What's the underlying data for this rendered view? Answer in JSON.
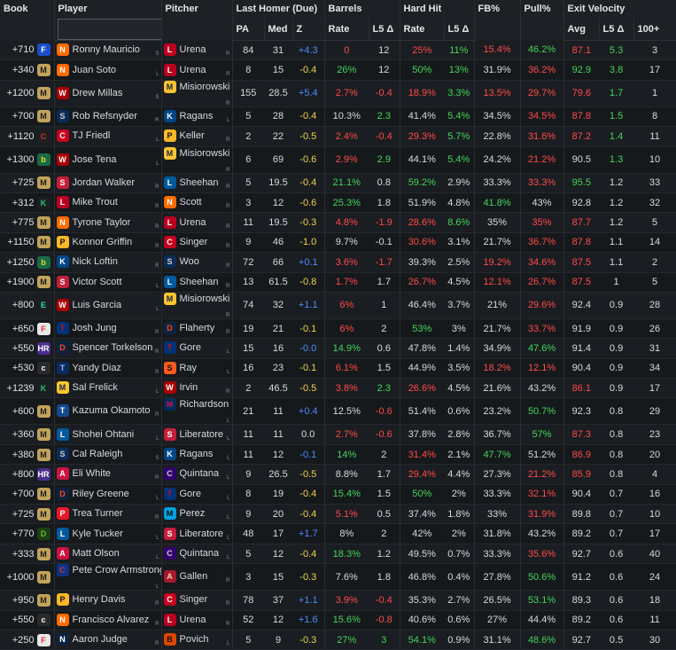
{
  "headers": {
    "book": "Book",
    "player": "Player",
    "pitcher": "Pitcher",
    "last_homer": "Last Homer (Due)",
    "barrels": "Barrels",
    "hard_hit": "Hard Hit",
    "fb": "FB%",
    "pull": "Pull%",
    "exit_velocity": "Exit Velocity",
    "pa": "PA",
    "med": "Med",
    "z": "Z",
    "rate1": "Rate",
    "l5a": "L5 Δ",
    "rate2": "Rate",
    "l5b": "L5 Δ",
    "avg": "Avg",
    "l5c": "L5 Δ",
    "hundred": "100+"
  },
  "search": {
    "placeholder": ""
  },
  "colors": {
    "negative": "#ff4a4a",
    "positive": "#43d55a",
    "z_positive": "#4d8cff",
    "bold_green": "#2ee14a"
  },
  "rows": [
    {
      "odds": "+710",
      "book": "fanduel",
      "player": "Ronny Mauricio",
      "ph": "S",
      "team": "NYM",
      "pitcher": "Urena",
      "th": "R",
      "pt": "LAA",
      "pa": "84",
      "med": "31",
      "z": "+4.3",
      "zc": "blue",
      "brate": "0",
      "brc": "neg",
      "bl5": "12",
      "bl5c": "",
      "hrate": "25%",
      "hrc": "neg",
      "hl5": "11%",
      "hl5c": "pos",
      "fb": "15.4%",
      "fbc": "neg",
      "pull": "46.2%",
      "pc": "pos",
      "avg": "87.1",
      "ac": "neg",
      "el5": "5.3",
      "ec": "pos",
      "hund": "3"
    },
    {
      "odds": "+340",
      "book": "mgm",
      "player": "Juan Soto",
      "ph": "L",
      "team": "NYM",
      "pitcher": "Urena",
      "th": "R",
      "pt": "LAA",
      "pa": "8",
      "med": "15",
      "z": "-0.4",
      "zc": "yel",
      "brate": "26%",
      "brc": "pos",
      "bl5": "12",
      "bl5c": "",
      "hrate": "50%",
      "hrc": "pos",
      "hl5": "13%",
      "hl5c": "pos",
      "fb": "31.9%",
      "fbc": "",
      "pull": "36.2%",
      "pc": "neg",
      "avg": "92.9",
      "ac": "pos",
      "el5": "3.8",
      "ec": "pos",
      "hund": "17"
    },
    {
      "odds": "+1200",
      "book": "mgm",
      "player": "Drew Millas",
      "ph": "S",
      "team": "WSH",
      "pitcher": "Misiorowski",
      "th": "R",
      "pt": "MIL",
      "pa": "155",
      "med": "28.5",
      "z": "+5.4",
      "zc": "blue",
      "brate": "2.7%",
      "brc": "neg",
      "bl5": "-0.4",
      "bl5c": "neg",
      "hrate": "18.9%",
      "hrc": "neg",
      "hl5": "3.3%",
      "hl5c": "pos",
      "fb": "13.5%",
      "fbc": "neg",
      "pull": "29.7%",
      "pc": "neg",
      "avg": "79.6",
      "ac": "neg",
      "el5": "1.7",
      "ec": "pos",
      "hund": "1"
    },
    {
      "odds": "+700",
      "book": "mgm",
      "player": "Rob Refsnyder",
      "ph": "R",
      "team": "SEA",
      "pitcher": "Ragans",
      "th": "L",
      "pt": "KC",
      "pa": "5",
      "med": "28",
      "z": "-0.4",
      "zc": "yel",
      "brate": "10.3%",
      "brc": "",
      "bl5": "2.3",
      "bl5c": "pos",
      "hrate": "41.4%",
      "hrc": "",
      "hl5": "5.4%",
      "hl5c": "pos",
      "fb": "34.5%",
      "fbc": "",
      "pull": "34.5%",
      "pc": "neg",
      "avg": "87.8",
      "ac": "neg",
      "el5": "1.5",
      "ec": "pos",
      "hund": "8"
    },
    {
      "odds": "+1120",
      "book": "caesars",
      "player": "TJ Friedl",
      "ph": "L",
      "team": "CIN",
      "pitcher": "Keller",
      "th": "R",
      "pt": "PIT",
      "pa": "2",
      "med": "22",
      "z": "-0.5",
      "zc": "yel",
      "brate": "2.4%",
      "brc": "neg",
      "bl5": "-0.4",
      "bl5c": "neg",
      "hrate": "29.3%",
      "hrc": "neg",
      "hl5": "5.7%",
      "hl5c": "pos",
      "fb": "22.8%",
      "fbc": "",
      "pull": "31.6%",
      "pc": "neg",
      "avg": "87.2",
      "ac": "neg",
      "el5": "1.4",
      "ec": "pos",
      "hund": "11"
    },
    {
      "odds": "+1300",
      "book": "bet365",
      "player": "Jose Tena",
      "ph": "L",
      "team": "WSH",
      "pitcher": "Misiorowski",
      "th": "R",
      "pt": "MIL",
      "pa": "6",
      "med": "69",
      "z": "-0.6",
      "zc": "yel",
      "brate": "2.9%",
      "brc": "neg",
      "bl5": "2.9",
      "bl5c": "pos",
      "hrate": "44.1%",
      "hrc": "",
      "hl5": "5.4%",
      "hl5c": "pos",
      "fb": "24.2%",
      "fbc": "",
      "pull": "21.2%",
      "pc": "neg",
      "avg": "90.5",
      "ac": "",
      "el5": "1.3",
      "ec": "pos",
      "hund": "10"
    },
    {
      "odds": "+725",
      "book": "mgm",
      "player": "Jordan Walker",
      "ph": "R",
      "team": "STL",
      "pitcher": "Sheehan",
      "th": "R",
      "pt": "LAD",
      "pa": "5",
      "med": "19.5",
      "z": "-0.4",
      "zc": "yel",
      "brate": "21.1%",
      "brc": "pos",
      "bl5": "0.8",
      "bl5c": "",
      "hrate": "59.2%",
      "hrc": "pos",
      "hl5": "2.9%",
      "hl5c": "",
      "fb": "33.3%",
      "fbc": "",
      "pull": "33.3%",
      "pc": "neg",
      "avg": "95.5",
      "ac": "pos",
      "el5": "1.2",
      "ec": "",
      "hund": "33"
    },
    {
      "odds": "+312",
      "book": "kalshi",
      "player": "Mike Trout",
      "ph": "R",
      "team": "LAA",
      "pitcher": "Scott",
      "th": "R",
      "pt": "NYM",
      "pa": "3",
      "med": "12",
      "z": "-0.6",
      "zc": "yel",
      "brate": "25.3%",
      "brc": "pos",
      "bl5": "1.8",
      "bl5c": "",
      "hrate": "51.9%",
      "hrc": "",
      "hl5": "4.8%",
      "hl5c": "",
      "fb": "41.8%",
      "fbc": "pos",
      "pull": "43%",
      "pc": "",
      "avg": "92.8",
      "ac": "",
      "el5": "1.2",
      "ec": "",
      "hund": "32"
    },
    {
      "odds": "+775",
      "book": "mgm",
      "player": "Tyrone Taylor",
      "ph": "R",
      "team": "NYM",
      "pitcher": "Urena",
      "th": "R",
      "pt": "LAA",
      "pa": "11",
      "med": "19.5",
      "z": "-0.3",
      "zc": "yel",
      "brate": "4.8%",
      "brc": "neg",
      "bl5": "-1.9",
      "bl5c": "neg",
      "hrate": "28.6%",
      "hrc": "neg",
      "hl5": "8.6%",
      "hl5c": "pos",
      "fb": "35%",
      "fbc": "",
      "pull": "35%",
      "pc": "neg",
      "avg": "87.7",
      "ac": "neg",
      "el5": "1.2",
      "ec": "",
      "hund": "5"
    },
    {
      "odds": "+1150",
      "book": "mgm",
      "player": "Konnor Griffin",
      "ph": "R",
      "team": "PIT",
      "pitcher": "Singer",
      "th": "R",
      "pt": "CIN",
      "pa": "9",
      "med": "46",
      "z": "-1.0",
      "zc": "yel",
      "brate": "9.7%",
      "brc": "",
      "bl5": "-0.1",
      "bl5c": "",
      "hrate": "30.6%",
      "hrc": "neg",
      "hl5": "3.1%",
      "hl5c": "",
      "fb": "21.7%",
      "fbc": "",
      "pull": "36.7%",
      "pc": "neg",
      "avg": "87.8",
      "ac": "neg",
      "el5": "1.1",
      "ec": "",
      "hund": "14"
    },
    {
      "odds": "+1250",
      "book": "bet365",
      "player": "Nick Loftin",
      "ph": "R",
      "team": "KC",
      "pitcher": "Woo",
      "th": "R",
      "pt": "SEA",
      "pa": "72",
      "med": "66",
      "z": "+0.1",
      "zc": "blue",
      "brate": "3.6%",
      "brc": "neg",
      "bl5": "-1.7",
      "bl5c": "neg",
      "hrate": "39.3%",
      "hrc": "",
      "hl5": "2.5%",
      "hl5c": "",
      "fb": "19.2%",
      "fbc": "neg",
      "pull": "34.6%",
      "pc": "neg",
      "avg": "87.5",
      "ac": "neg",
      "el5": "1.1",
      "ec": "",
      "hund": "2"
    },
    {
      "odds": "+1900",
      "book": "mgm",
      "player": "Victor Scott",
      "ph": "L",
      "team": "STL",
      "pitcher": "Sheehan",
      "th": "R",
      "pt": "LAD",
      "pa": "13",
      "med": "61.5",
      "z": "-0.8",
      "zc": "yel",
      "brate": "1.7%",
      "brc": "neg",
      "bl5": "1.7",
      "bl5c": "",
      "hrate": "26.7%",
      "hrc": "neg",
      "hl5": "4.5%",
      "hl5c": "",
      "fb": "12.1%",
      "fbc": "neg",
      "pull": "26.7%",
      "pc": "neg",
      "avg": "87.5",
      "ac": "neg",
      "el5": "1",
      "ec": "",
      "hund": "5"
    },
    {
      "odds": "+800",
      "book": "espn",
      "player": "Luis Garcia",
      "ph": "L",
      "team": "WSH",
      "pitcher": "Misiorowski",
      "th": "R",
      "pt": "MIL",
      "pa": "74",
      "med": "32",
      "z": "+1.1",
      "zc": "blue",
      "brate": "6%",
      "brc": "neg",
      "bl5": "1",
      "bl5c": "",
      "hrate": "46.4%",
      "hrc": "",
      "hl5": "3.7%",
      "hl5c": "",
      "fb": "21%",
      "fbc": "",
      "pull": "29.6%",
      "pc": "neg",
      "avg": "92.4",
      "ac": "",
      "el5": "0.9",
      "ec": "",
      "hund": "28"
    },
    {
      "odds": "+650",
      "book": "fanatics",
      "player": "Josh Jung",
      "ph": "R",
      "team": "TEX",
      "pitcher": "Flaherty",
      "th": "R",
      "pt": "DET",
      "pa": "19",
      "med": "21",
      "z": "-0.1",
      "zc": "yel",
      "brate": "6%",
      "brc": "neg",
      "bl5": "2",
      "bl5c": "",
      "hrate": "53%",
      "hrc": "pos",
      "hl5": "3%",
      "hl5c": "",
      "fb": "21.7%",
      "fbc": "",
      "pull": "33.7%",
      "pc": "neg",
      "avg": "91.9",
      "ac": "",
      "el5": "0.9",
      "ec": "",
      "hund": "26"
    },
    {
      "odds": "+550",
      "book": "hardrock",
      "player": "Spencer Torkelson",
      "ph": "R",
      "team": "DET",
      "pitcher": "Gore",
      "th": "L",
      "pt": "TEX",
      "pa": "15",
      "med": "16",
      "z": "-0.0",
      "zc": "blue",
      "brate": "14.9%",
      "brc": "pos",
      "bl5": "0.6",
      "bl5c": "",
      "hrate": "47.8%",
      "hrc": "",
      "hl5": "1.4%",
      "hl5c": "",
      "fb": "34.9%",
      "fbc": "",
      "pull": "47.6%",
      "pc": "pos",
      "avg": "91.4",
      "ac": "",
      "el5": "0.9",
      "ec": "",
      "hund": "31"
    },
    {
      "odds": "+530",
      "book": "circa",
      "player": "Yandy Diaz",
      "ph": "R",
      "team": "TB",
      "pitcher": "Ray",
      "th": "L",
      "pt": "SF",
      "pa": "16",
      "med": "23",
      "z": "-0.1",
      "zc": "yel",
      "brate": "6.1%",
      "brc": "neg",
      "bl5": "1.5",
      "bl5c": "",
      "hrate": "44.9%",
      "hrc": "",
      "hl5": "3.5%",
      "hl5c": "",
      "fb": "18.2%",
      "fbc": "neg",
      "pull": "12.1%",
      "pc": "neg",
      "avg": "90.4",
      "ac": "",
      "el5": "0.9",
      "ec": "",
      "hund": "34"
    },
    {
      "odds": "+1239",
      "book": "kalshi",
      "player": "Sal Frelick",
      "ph": "L",
      "team": "MIL",
      "pitcher": "Irvin",
      "th": "R",
      "pt": "WSH",
      "pa": "2",
      "med": "46.5",
      "z": "-0.5",
      "zc": "yel",
      "brate": "3.8%",
      "brc": "neg",
      "bl5": "2.3",
      "bl5c": "pos",
      "hrate": "26.6%",
      "hrc": "neg",
      "hl5": "4.5%",
      "hl5c": "",
      "fb": "21.6%",
      "fbc": "",
      "pull": "43.2%",
      "pc": "",
      "avg": "86.1",
      "ac": "neg",
      "el5": "0.9",
      "ec": "",
      "hund": "17"
    },
    {
      "odds": "+600",
      "book": "mgm",
      "player": "Kazuma Okamoto",
      "ph": "R",
      "team": "TOR",
      "pitcher": "Richardson",
      "th": "L",
      "pt": "MIN",
      "pa": "21",
      "med": "11",
      "z": "+0.4",
      "zc": "blue",
      "brate": "12.5%",
      "brc": "",
      "bl5": "-0.6",
      "bl5c": "neg",
      "hrate": "51.4%",
      "hrc": "",
      "hl5": "0.6%",
      "hl5c": "",
      "fb": "23.2%",
      "fbc": "",
      "pull": "50.7%",
      "pc": "pos",
      "avg": "92.3",
      "ac": "",
      "el5": "0.8",
      "ec": "",
      "hund": "29"
    },
    {
      "odds": "+360",
      "book": "mgm",
      "player": "Shohei Ohtani",
      "ph": "L",
      "team": "LAD",
      "pitcher": "Liberatore",
      "th": "L",
      "pt": "STL",
      "pa": "11",
      "med": "11",
      "z": "0.0",
      "zc": "",
      "brate": "2.7%",
      "brc": "neg",
      "bl5": "-0.6",
      "bl5c": "neg",
      "hrate": "37.8%",
      "hrc": "",
      "hl5": "2.8%",
      "hl5c": "",
      "fb": "36.7%",
      "fbc": "",
      "pull": "57%",
      "pc": "pos",
      "avg": "87.3",
      "ac": "neg",
      "el5": "0.8",
      "ec": "",
      "hund": "23"
    },
    {
      "odds": "+380",
      "book": "mgm",
      "player": "Cal Raleigh",
      "ph": "S",
      "team": "SEA",
      "pitcher": "Ragans",
      "th": "L",
      "pt": "KC",
      "pa": "11",
      "med": "12",
      "z": "-0.1",
      "zc": "blue",
      "brate": "14%",
      "brc": "pos",
      "bl5": "2",
      "bl5c": "",
      "hrate": "31.4%",
      "hrc": "neg",
      "hl5": "2.1%",
      "hl5c": "",
      "fb": "47.7%",
      "fbc": "pos",
      "pull": "51.2%",
      "pc": "",
      "avg": "86.9",
      "ac": "neg",
      "el5": "0.8",
      "ec": "",
      "hund": "20"
    },
    {
      "odds": "+800",
      "book": "hardrock",
      "player": "Eli White",
      "ph": "R",
      "team": "ATL",
      "pitcher": "Quintana",
      "th": "L",
      "pt": "COL",
      "pa": "9",
      "med": "26.5",
      "z": "-0.5",
      "zc": "yel",
      "brate": "8.8%",
      "brc": "",
      "bl5": "1.7",
      "bl5c": "",
      "hrate": "29.4%",
      "hrc": "neg",
      "hl5": "4.4%",
      "hl5c": "",
      "fb": "27.3%",
      "fbc": "",
      "pull": "21.2%",
      "pc": "neg",
      "avg": "85.9",
      "ac": "neg",
      "el5": "0.8",
      "ec": "",
      "hund": "4"
    },
    {
      "odds": "+700",
      "book": "mgm",
      "player": "Riley Greene",
      "ph": "L",
      "team": "DET",
      "pitcher": "Gore",
      "th": "L",
      "pt": "TEX",
      "pa": "8",
      "med": "19",
      "z": "-0.4",
      "zc": "yel",
      "brate": "15.4%",
      "brc": "pos",
      "bl5": "1.5",
      "bl5c": "",
      "hrate": "50%",
      "hrc": "pos",
      "hl5": "2%",
      "hl5c": "",
      "fb": "33.3%",
      "fbc": "",
      "pull": "32.1%",
      "pc": "neg",
      "avg": "90.4",
      "ac": "",
      "el5": "0.7",
      "ec": "",
      "hund": "16"
    },
    {
      "odds": "+725",
      "book": "mgm",
      "player": "Trea Turner",
      "ph": "R",
      "team": "PHI",
      "pitcher": "Perez",
      "th": "L",
      "pt": "MIA",
      "pa": "9",
      "med": "20",
      "z": "-0.4",
      "zc": "yel",
      "brate": "5.1%",
      "brc": "neg",
      "bl5": "0.5",
      "bl5c": "",
      "hrate": "37.4%",
      "hrc": "",
      "hl5": "1.8%",
      "hl5c": "",
      "fb": "33%",
      "fbc": "",
      "pull": "31.9%",
      "pc": "neg",
      "avg": "89.8",
      "ac": "",
      "el5": "0.7",
      "ec": "",
      "hund": "10"
    },
    {
      "odds": "+770",
      "book": "draftkings",
      "player": "Kyle Tucker",
      "ph": "L",
      "team": "LAD",
      "pitcher": "Liberatore",
      "th": "L",
      "pt": "STL",
      "pa": "48",
      "med": "17",
      "z": "+1.7",
      "zc": "blue",
      "brate": "8%",
      "brc": "",
      "bl5": "2",
      "bl5c": "",
      "hrate": "42%",
      "hrc": "",
      "hl5": "2%",
      "hl5c": "",
      "fb": "31.8%",
      "fbc": "",
      "pull": "43.2%",
      "pc": "",
      "avg": "89.2",
      "ac": "",
      "el5": "0.7",
      "ec": "",
      "hund": "17"
    },
    {
      "odds": "+333",
      "book": "mgm",
      "player": "Matt Olson",
      "ph": "L",
      "team": "ATL",
      "pitcher": "Quintana",
      "th": "L",
      "pt": "COL",
      "pa": "5",
      "med": "12",
      "z": "-0.4",
      "zc": "yel",
      "brate": "18.3%",
      "brc": "pos",
      "bl5": "1.2",
      "bl5c": "",
      "hrate": "49.5%",
      "hrc": "",
      "hl5": "0.7%",
      "hl5c": "",
      "fb": "33.3%",
      "fbc": "",
      "pull": "35.6%",
      "pc": "neg",
      "avg": "92.7",
      "ac": "",
      "el5": "0.6",
      "ec": "",
      "hund": "40"
    },
    {
      "odds": "+1000",
      "book": "mgm",
      "player": "Pete Crow Armstrong",
      "ph": "L",
      "team": "CHC",
      "pitcher": "Gallen",
      "th": "R",
      "pt": "ARI",
      "pa": "3",
      "med": "15",
      "z": "-0.3",
      "zc": "yel",
      "brate": "7.6%",
      "brc": "",
      "bl5": "1.8",
      "bl5c": "",
      "hrate": "46.8%",
      "hrc": "",
      "hl5": "0.4%",
      "hl5c": "",
      "fb": "27.8%",
      "fbc": "",
      "pull": "50.6%",
      "pc": "pos",
      "avg": "91.2",
      "ac": "",
      "el5": "0.6",
      "ec": "",
      "hund": "24"
    },
    {
      "odds": "+950",
      "book": "mgm",
      "player": "Henry Davis",
      "ph": "R",
      "team": "PIT",
      "pitcher": "Singer",
      "th": "R",
      "pt": "CIN",
      "pa": "78",
      "med": "37",
      "z": "+1.1",
      "zc": "blue",
      "brate": "3.9%",
      "brc": "neg",
      "bl5": "-0.4",
      "bl5c": "neg",
      "hrate": "35.3%",
      "hrc": "",
      "hl5": "2.7%",
      "hl5c": "",
      "fb": "26.5%",
      "fbc": "",
      "pull": "53.1%",
      "pc": "pos",
      "avg": "89.3",
      "ac": "",
      "el5": "0.6",
      "ec": "",
      "hund": "18"
    },
    {
      "odds": "+550",
      "book": "circa",
      "player": "Francisco Alvarez",
      "ph": "R",
      "team": "NYM",
      "pitcher": "Urena",
      "th": "R",
      "pt": "LAA",
      "pa": "52",
      "med": "12",
      "z": "+1.6",
      "zc": "blue",
      "brate": "15.6%",
      "brc": "pos",
      "bl5": "-0.8",
      "bl5c": "neg",
      "hrate": "40.6%",
      "hrc": "",
      "hl5": "0.6%",
      "hl5c": "",
      "fb": "27%",
      "fbc": "",
      "pull": "44.4%",
      "pc": "",
      "avg": "89.2",
      "ac": "",
      "el5": "0.6",
      "ec": "",
      "hund": "11"
    },
    {
      "odds": "+250",
      "book": "fanatics",
      "player": "Aaron Judge",
      "ph": "R",
      "team": "NYY",
      "pitcher": "Povich",
      "th": "L",
      "pt": "BAL",
      "pa": "5",
      "med": "9",
      "z": "-0.3",
      "zc": "yel",
      "brate": "27%",
      "brc": "pos",
      "bl5": "3",
      "bl5c": "pos",
      "hrate": "54.1%",
      "hrc": "pos",
      "hl5": "0.9%",
      "hl5c": "",
      "fb": "31.1%",
      "fbc": "",
      "pull": "48.6%",
      "pc": "pos",
      "avg": "92.7",
      "ac": "",
      "el5": "0.5",
      "ec": "",
      "hund": "30"
    }
  ]
}
